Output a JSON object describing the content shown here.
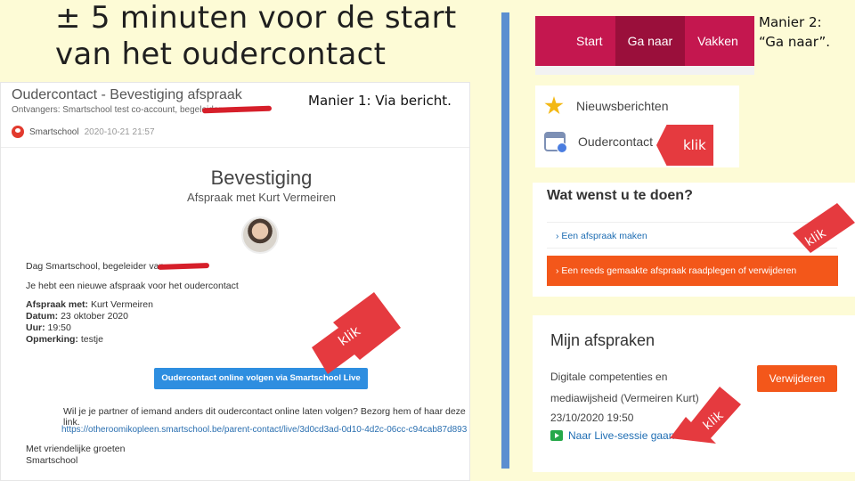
{
  "slide": {
    "title": "± 5 minuten voor de start van het oudercontact",
    "manier1": "Manier 1: Via bericht.",
    "manier2_line1": "Manier 2:",
    "manier2_line2": "“Ga naar”."
  },
  "email": {
    "subject": "Oudercontact - Bevestiging afspraak",
    "recipients": "Ontvangers: Smartschool test co-account, begeleider van",
    "sender": "Smartschool",
    "date": "2020-10-21 21:57",
    "heading": "Bevestiging",
    "subheading": "Afspraak met Kurt Vermeiren",
    "greeting": "Dag Smartschool, begeleider van",
    "intro": "Je hebt een nieuwe afspraak voor het oudercontact",
    "details": [
      {
        "label": "Afspraak met:",
        "value": "Kurt Vermeiren"
      },
      {
        "label": "Datum:",
        "value": "23 oktober 2020"
      },
      {
        "label": "Uur:",
        "value": "19:50"
      },
      {
        "label": "Opmerking:",
        "value": "testje"
      }
    ],
    "cta": "Oudercontact online volgen via Smartschool Live",
    "partner_question": "Wil je je partner of iemand anders dit oudercontact online laten volgen? Bezorg hem of haar deze link.",
    "link": "https://otheroomikopleen.smartschool.be/parent-contact/live/3d0cd3ad-0d10-4d2c-06cc-c94cab87d893",
    "closing1": "Met vriendelijke groeten",
    "closing2": "Smartschool"
  },
  "nav": {
    "items": [
      "Start",
      "Ga naar",
      "Vakken"
    ],
    "active": "Ga naar"
  },
  "menu": {
    "items": [
      {
        "label": "Nieuwsberichten",
        "icon": "star-icon"
      },
      {
        "label": "Oudercontact",
        "icon": "calendar-icon"
      }
    ]
  },
  "choice": {
    "title": "Wat wenst u te doen?",
    "option1": "› Een afspraak maken",
    "option2": "› Een reeds gemaakte afspraak raadplegen of verwijderen"
  },
  "afspraken": {
    "title": "Mijn afspraken",
    "line1": "Digitale competenties en",
    "line2": "mediawijsheid (Vermeiren Kurt)",
    "datetime": "23/10/2020 19:50",
    "delete_button": "Verwijderen",
    "live_link": "Naar Live-sessie gaan"
  },
  "annotations": {
    "klik": "klik"
  },
  "colors": {
    "background": "#fdfbd6",
    "nav": "#c4174f",
    "accent_orange": "#f3571a",
    "arrow_red": "#e53a3f",
    "divider_blue": "#5b8fd0"
  }
}
